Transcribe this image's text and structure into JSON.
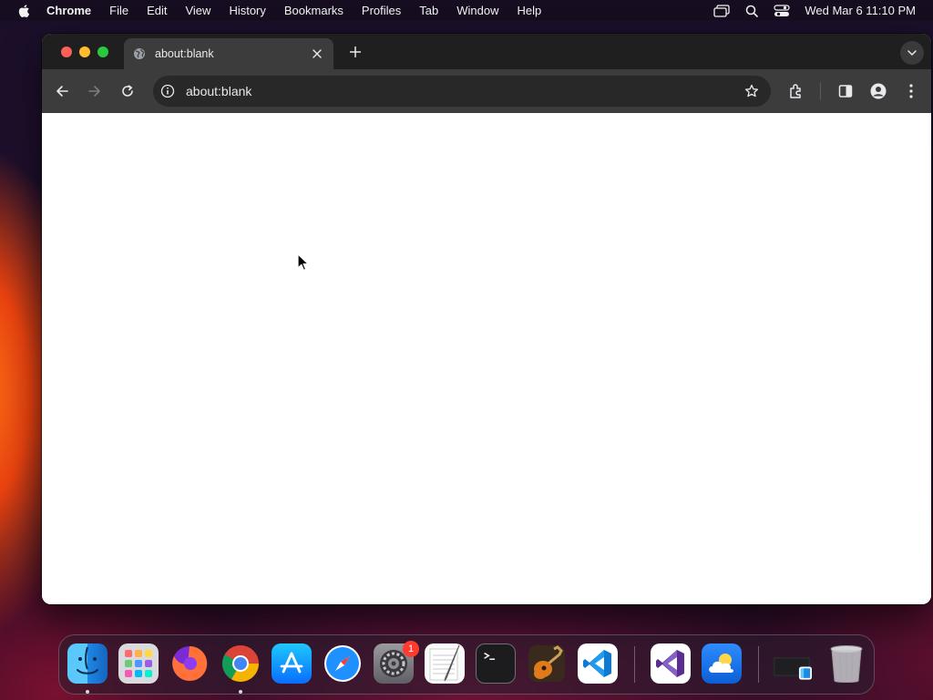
{
  "menubar": {
    "app_name": "Chrome",
    "items": [
      "File",
      "Edit",
      "View",
      "History",
      "Bookmarks",
      "Profiles",
      "Tab",
      "Window",
      "Help"
    ],
    "clock": "Wed Mar 6  11:10 PM"
  },
  "browser": {
    "tab_title": "about:blank",
    "url": "about:blank"
  },
  "dock": {
    "apps": [
      "Finder",
      "Launchpad",
      "Firefox",
      "Google Chrome",
      "App Store",
      "Safari",
      "System Settings",
      "TextEdit",
      "Terminal",
      "GarageBand",
      "Visual Studio Code",
      "Visual Studio",
      "Weather",
      "Downloads",
      "Trash"
    ],
    "settings_badge": "1"
  },
  "colors": {
    "accent_blue": "#0a84ff",
    "badge_red": "#ff3b30"
  }
}
